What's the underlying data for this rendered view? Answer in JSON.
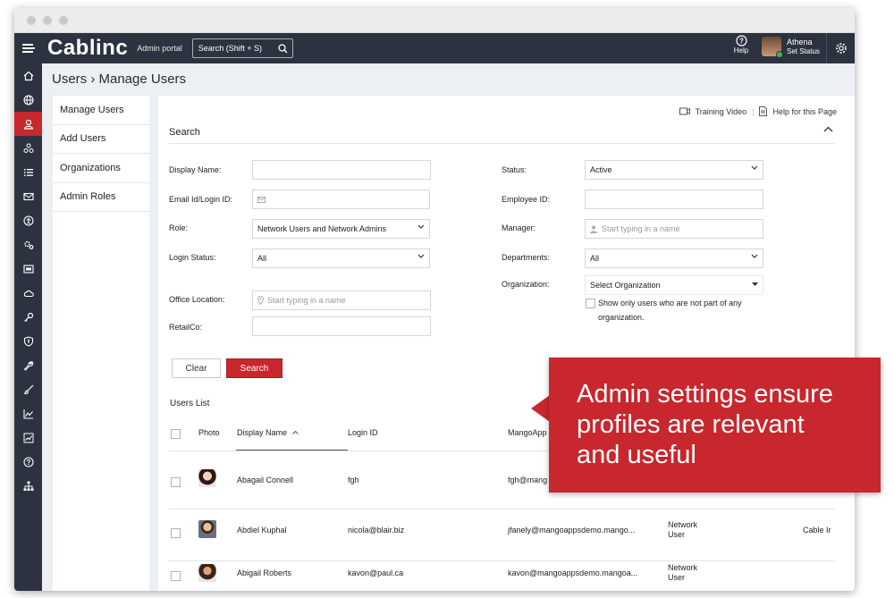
{
  "topbar": {
    "brand": "Cablinc",
    "portal_label": "Admin portal",
    "search_label": "Search (Shift + S)",
    "help_label": "Help",
    "user_name": "Athena",
    "user_status": "Set Status"
  },
  "leftnav": [
    "home-icon",
    "globe-icon",
    "user-icon",
    "network-icon",
    "list-icon",
    "mail-icon",
    "accessibility-icon",
    "settings-cog-icon",
    "card-icon",
    "cloud-icon",
    "key-icon",
    "shield-icon",
    "wrench-icon",
    "brush-icon",
    "chart-icon",
    "trend-icon",
    "help-icon",
    "org-chart-icon"
  ],
  "page": {
    "title": "Users › Manage Users"
  },
  "subnav": {
    "items": [
      "Manage Users",
      "Add Users",
      "Organizations",
      "Admin Roles"
    ]
  },
  "links": {
    "training_video": "Training Video",
    "help_page": "Help for this Page"
  },
  "search": {
    "section_title": "Search",
    "display_name_label": "Display Name:",
    "email_label": "Email Id/Login ID:",
    "role_label": "Role:",
    "role_value": "Network Users and Network Admins",
    "login_status_label": "Login Status:",
    "login_status_value": "All",
    "office_location_label": "Office Location:",
    "office_location_placeholder": "Start typing in a name",
    "retailco_label": "RetailCo:",
    "status_label": "Status:",
    "status_value": "Active",
    "employee_id_label": "Employee ID:",
    "manager_label": "Manager:",
    "manager_placeholder": "Start typing in a name",
    "departments_label": "Departments:",
    "departments_value": "All",
    "organization_label": "Organization:",
    "organization_value": "Select Organization",
    "show_only_label_1": "Show only users who are not part of any",
    "show_only_label_2": "organization.",
    "clear_button": "Clear",
    "search_button": "Search"
  },
  "users_list": {
    "title": "Users List",
    "columns": {
      "photo": "Photo",
      "display_name": "Display Name",
      "login_id": "Login ID",
      "mangoapps": "MangoApp"
    },
    "rows": [
      {
        "name": "Abagail Connell",
        "login": "fgh",
        "email": "fgh@mang",
        "type1": "",
        "type2": "",
        "company": ""
      },
      {
        "name": "Abdiel Kuphal",
        "login": "nicola@blair.biz",
        "email": "jfanely@mangoappsdemo.mango...",
        "type1": "Network",
        "type2": "User",
        "company": "Cable Ir"
      },
      {
        "name": "Abigail Roberts",
        "login": "kavon@paul.ca",
        "email": "kavon@mangoappsdemo.mangoa...",
        "type1": "Network",
        "type2": "User",
        "company": ""
      }
    ]
  },
  "callout": {
    "line1": "Admin settings ensure",
    "line2": "profiles are relevant",
    "line3": "and useful"
  },
  "colors": {
    "accent": "#c8272d",
    "dark": "#2d3240",
    "background": "#eceff3"
  }
}
